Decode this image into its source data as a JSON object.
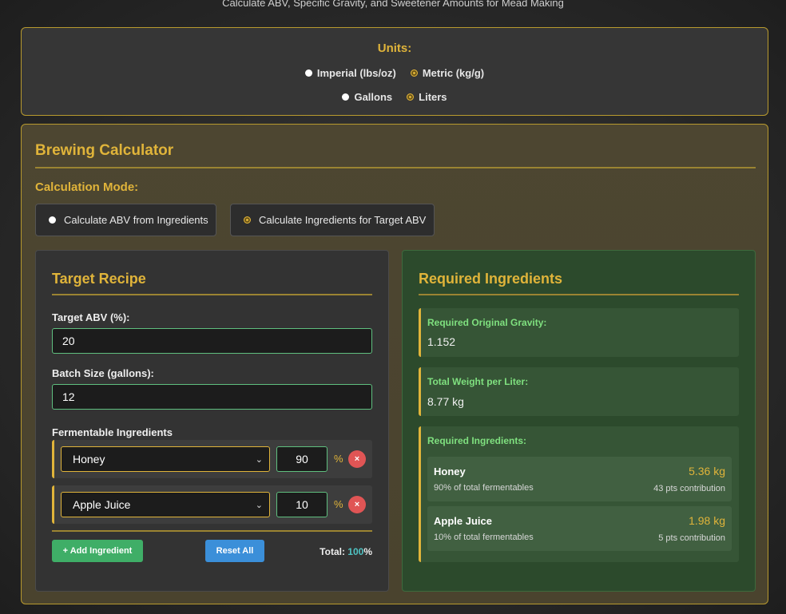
{
  "header": {
    "subtitle": "Calculate ABV, Specific Gravity, and Sweetener Amounts for Mead Making"
  },
  "units": {
    "title": "Units:",
    "weight_options": [
      {
        "label": "Imperial (lbs/oz)",
        "selected": false
      },
      {
        "label": "Metric (kg/g)",
        "selected": true
      }
    ],
    "volume_options": [
      {
        "label": "Gallons",
        "selected": false
      },
      {
        "label": "Liters",
        "selected": true
      }
    ]
  },
  "calculator": {
    "title": "Brewing Calculator",
    "mode_label": "Calculation Mode:",
    "modes": [
      {
        "label": "Calculate ABV from Ingredients",
        "selected": false
      },
      {
        "label": "Calculate Ingredients for Target ABV",
        "selected": true
      }
    ]
  },
  "target_recipe": {
    "title": "Target Recipe",
    "abv_label": "Target ABV (%):",
    "abv_value": "20",
    "batch_label": "Batch Size (gallons):",
    "batch_value": "12",
    "fermentables_label": "Fermentable Ingredients",
    "ingredients": [
      {
        "name": "Honey",
        "percent": "90"
      },
      {
        "name": "Apple Juice",
        "percent": "10"
      }
    ],
    "percent_sign": "%",
    "remove_label": "×",
    "add_label": "+ Add Ingredient",
    "reset_label": "Reset All",
    "total_label": "Total:",
    "total_value": "100",
    "total_unit": "%"
  },
  "required": {
    "title": "Required Ingredients",
    "og_label": "Required Original Gravity:",
    "og_value": "1.152",
    "weight_label": "Total Weight per Liter:",
    "weight_value": "8.77 kg",
    "ingredients_label": "Required Ingredients:",
    "items": [
      {
        "name": "Honey",
        "share": "90% of total fermentables",
        "amount": "5.36 kg",
        "points": "43 pts contribution"
      },
      {
        "name": "Apple Juice",
        "share": "10% of total fermentables",
        "amount": "1.98 kg",
        "points": "5 pts contribution"
      }
    ]
  },
  "colors": {
    "accent": "#e0b43a",
    "success": "#3fae67",
    "info": "#3b8fd9",
    "danger": "#e05555",
    "green_label": "#7fe07f"
  }
}
